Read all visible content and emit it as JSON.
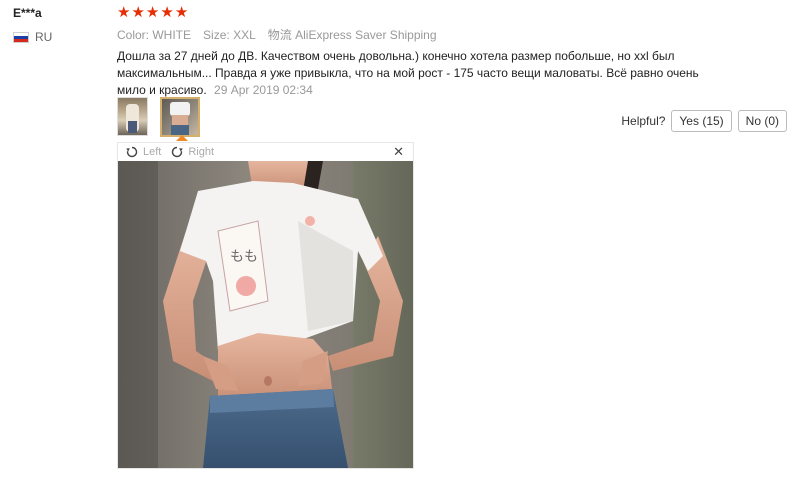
{
  "user": {
    "name": "E***a",
    "country": "RU"
  },
  "review": {
    "stars": [
      "★",
      "★",
      "★",
      "★",
      "★"
    ],
    "color_label": "Color:",
    "color_value": "WHITE",
    "size_label": "Size:",
    "size_value": "XXL",
    "shipping_label": "物流",
    "shipping_value": "AliExpress Saver Shipping",
    "text": "Дошла за 27 дней до ДВ. Качеством очень довольна.) конечно хотела размер побольше, но xxl был максимальным... Правда я уже привыкла, что на мой рост - 175 часто вещи маловаты. Всё равно очень мило и красиво.",
    "date": "29 Apr 2019 02:34"
  },
  "helpful": {
    "label": "Helpful?",
    "yes_label": "Yes (15)",
    "no_label": "No (0)"
  },
  "viewer": {
    "rotate_left_label": "Left",
    "rotate_right_label": "Right",
    "close_icon": "close-icon",
    "close_glyph": "✕"
  },
  "colors": {
    "star": "#e62e04",
    "active_thumb_border": "#d4b06a",
    "thumb_arrow": "#f08a24"
  }
}
